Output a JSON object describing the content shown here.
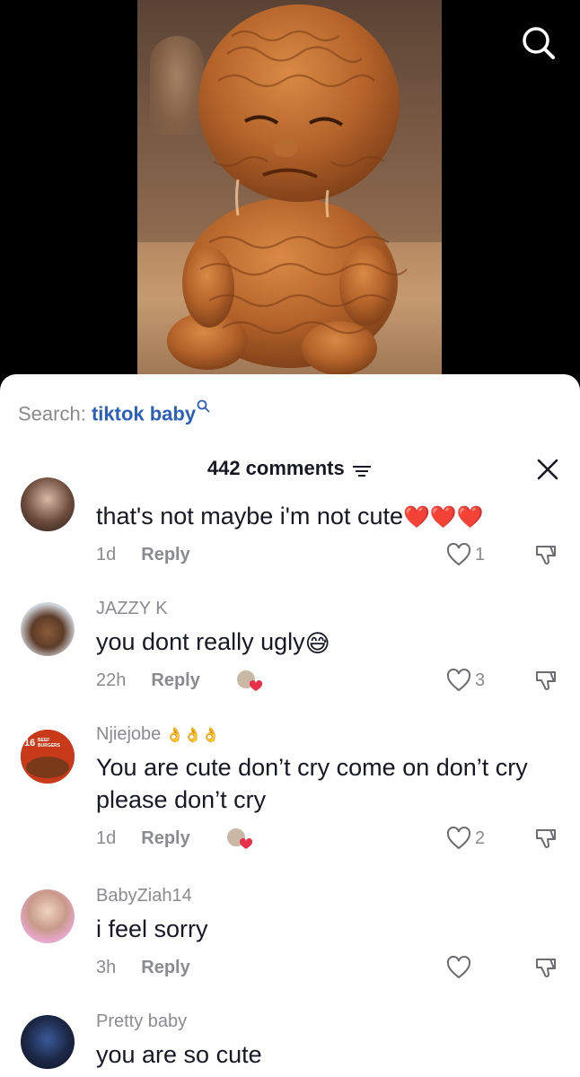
{
  "search": {
    "prefix": "Search: ",
    "query": "tiktok baby"
  },
  "header": {
    "count_label": "442 comments"
  },
  "comments": [
    {
      "username": "",
      "text": "that's not maybe i'm not cute",
      "text_emoji": "❤️❤️❤️",
      "time": "1d",
      "reply": "Reply",
      "likes": "1",
      "creator_liked": false
    },
    {
      "username": "JAZZY K",
      "text": "you dont really ugly",
      "text_emoji": "😅",
      "time": "22h",
      "reply": "Reply",
      "likes": "3",
      "creator_liked": true
    },
    {
      "username": "Njiejobe",
      "username_emoji": "👌👌👌",
      "text": "You are cute don’t cry come on don’t cry please don’t cry",
      "time": "1d",
      "reply": "Reply",
      "likes": "2",
      "creator_liked": true,
      "avatar_text_top": "BEEF",
      "avatar_text_bottom": "BURGERS",
      "avatar_number": "16"
    },
    {
      "username": "BabyZiah14",
      "text": "i feel sorry",
      "time": "3h",
      "reply": "Reply",
      "likes": "",
      "creator_liked": false
    },
    {
      "username": "Pretty baby",
      "text": "you are so cute"
    }
  ],
  "colors": {
    "link": "#2b5fb8",
    "heart": "#e8304a",
    "muted": "#8a8b91",
    "text": "#161823"
  },
  "icons": [
    "search-icon",
    "sort-icon",
    "close-icon",
    "heart-outline-icon",
    "thumbs-down-icon",
    "creator-liked-icon"
  ]
}
